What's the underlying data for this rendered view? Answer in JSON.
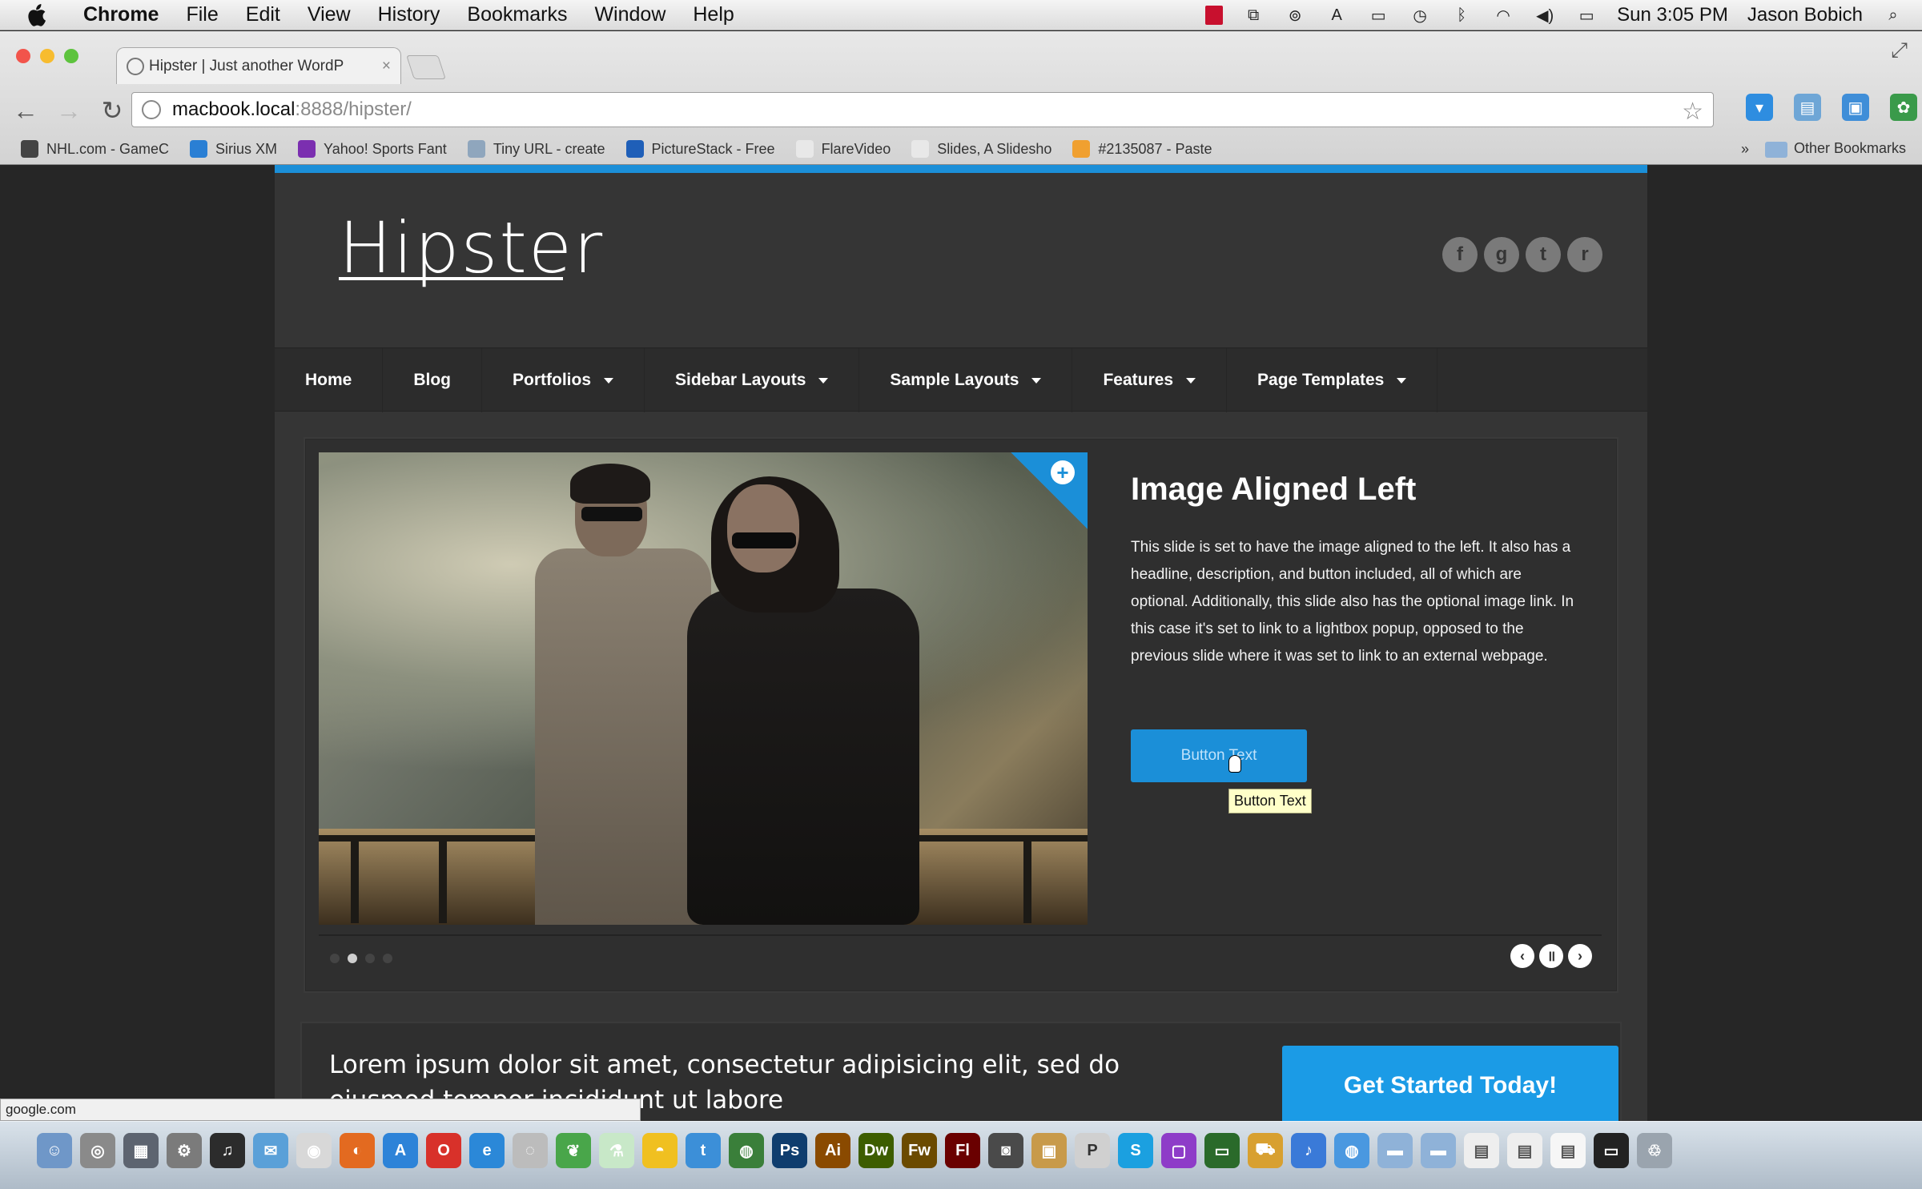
{
  "menubar": {
    "app": "Chrome",
    "items": [
      "File",
      "Edit",
      "View",
      "History",
      "Bookmarks",
      "Window",
      "Help"
    ],
    "clock": "Sun 3:05 PM",
    "user": "Jason Bobich",
    "status_icons": [
      "record-icon",
      "screen-icon",
      "sync-icon",
      "input-icon",
      "display-icon",
      "time-machine-icon",
      "bluetooth-icon",
      "wifi-icon",
      "volume-icon",
      "battery-icon"
    ]
  },
  "browser": {
    "tab_title": "Hipster | Just another WordP",
    "tab_close": "×",
    "url_host": "macbook.local",
    "url_rest": ":8888/hipster/",
    "bookmarks": [
      "NHL.com - GameC",
      "Sirius XM",
      "Yahoo! Sports Fant",
      "Tiny URL - create",
      "PictureStack - Free",
      "FlareVideo",
      "Slides, A Slidesho",
      "#2135087 - Paste"
    ],
    "other_bookmarks": "Other Bookmarks",
    "overflow": "»",
    "status_url": "google.com"
  },
  "site": {
    "logo": "Hipster",
    "social": [
      "f",
      "g",
      "t",
      "r"
    ],
    "social_names": [
      "facebook-icon",
      "google-plus-icon",
      "twitter-icon",
      "rss-icon"
    ],
    "nav": [
      {
        "label": "Home",
        "dropdown": false
      },
      {
        "label": "Blog",
        "dropdown": false
      },
      {
        "label": "Portfolios",
        "dropdown": true
      },
      {
        "label": "Sidebar Layouts",
        "dropdown": true
      },
      {
        "label": "Sample Layouts",
        "dropdown": true
      },
      {
        "label": "Features",
        "dropdown": true
      },
      {
        "label": "Page Templates",
        "dropdown": true
      }
    ],
    "slide": {
      "title": "Image Aligned Left",
      "description": "This slide is set to have the image aligned to the left. It also has a headline, description, and button included, all of which are optional. Additionally, this slide also has the optional image link. In this case it's set to link to a lightbox popup, opposed to the previous slide where it was set to link to an external webpage.",
      "button": "Button Text",
      "tooltip": "Button Text",
      "active_dot": 1,
      "dot_count": 4
    },
    "cta": {
      "text": "Lorem ipsum dolor sit amet, consectetur adipisicing elit, sed do eiusmod tempor incididunt ut labore",
      "button": "Get Started Today!"
    }
  },
  "colors": {
    "accent": "#1b8fd8",
    "page_bg": "#262626",
    "site_bg": "#353535"
  },
  "dock": [
    "finder",
    "safari",
    "preview",
    "settings",
    "itunes",
    "mail",
    "chrome",
    "firefox",
    "app-store",
    "opera",
    "ie",
    "app1",
    "leaf",
    "flask",
    "duck",
    "tweetdeck",
    "globe",
    "ps",
    "ai",
    "dw",
    "fw",
    "fl",
    "screenshot",
    "box",
    "pages",
    "skype",
    "purple",
    "screen",
    "cart",
    "itunes-app",
    "globe2",
    "folder1",
    "folder2",
    "doc",
    "docs2",
    "doc3",
    "trash"
  ]
}
